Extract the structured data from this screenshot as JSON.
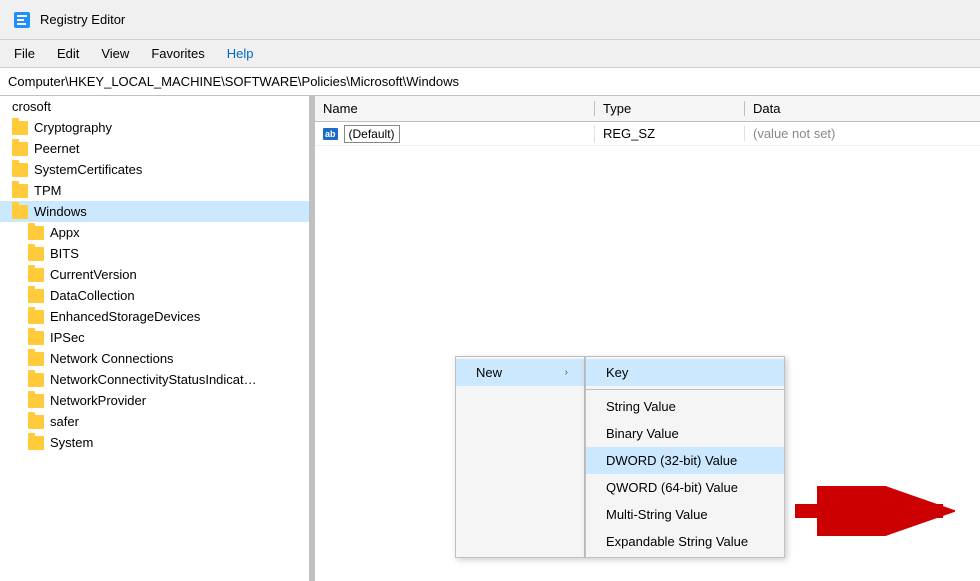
{
  "titleBar": {
    "title": "Registry Editor"
  },
  "menuBar": {
    "items": [
      "File",
      "Edit",
      "View",
      "Favorites",
      "Help"
    ]
  },
  "addressBar": {
    "path": "Computer\\HKEY_LOCAL_MACHINE\\SOFTWARE\\Policies\\Microsoft\\Windows"
  },
  "treePanel": {
    "items": [
      {
        "label": "crosoft",
        "type": "plain"
      },
      {
        "label": "Cryptography",
        "type": "folder"
      },
      {
        "label": "Peernet",
        "type": "folder"
      },
      {
        "label": "SystemCertificates",
        "type": "folder"
      },
      {
        "label": "TPM",
        "type": "folder"
      },
      {
        "label": "Windows",
        "type": "folder",
        "selected": true
      },
      {
        "label": "Appx",
        "type": "folder",
        "indent": true
      },
      {
        "label": "BITS",
        "type": "folder",
        "indent": true
      },
      {
        "label": "CurrentVersion",
        "type": "folder",
        "indent": true
      },
      {
        "label": "DataCollection",
        "type": "folder",
        "indent": true
      },
      {
        "label": "EnhancedStorageDevices",
        "type": "folder",
        "indent": true
      },
      {
        "label": "IPSec",
        "type": "folder",
        "indent": true
      },
      {
        "label": "Network Connections",
        "type": "folder",
        "indent": true
      },
      {
        "label": "NetworkConnectivityStatusIndicat…",
        "type": "folder",
        "indent": true
      },
      {
        "label": "NetworkProvider",
        "type": "folder",
        "indent": true
      },
      {
        "label": "safer",
        "type": "folder",
        "indent": true
      },
      {
        "label": "System",
        "type": "folder",
        "indent": true
      }
    ]
  },
  "tableHeader": {
    "nameCol": "Name",
    "typeCol": "Type",
    "dataCol": "Data"
  },
  "tableRows": [
    {
      "name": "(Default)",
      "type": "REG_SZ",
      "data": "(value not set)",
      "hasIcon": true
    }
  ],
  "contextMenu": {
    "newLabel": "New",
    "arrowChar": "›",
    "submenuItems": [
      {
        "label": "Key",
        "separator": true
      },
      {
        "label": "String Value"
      },
      {
        "label": "Binary Value"
      },
      {
        "label": "DWORD (32-bit) Value",
        "highlighted": true
      },
      {
        "label": "QWORD (64-bit) Value"
      },
      {
        "label": "Multi-String Value"
      },
      {
        "label": "Expandable String Value"
      }
    ]
  }
}
